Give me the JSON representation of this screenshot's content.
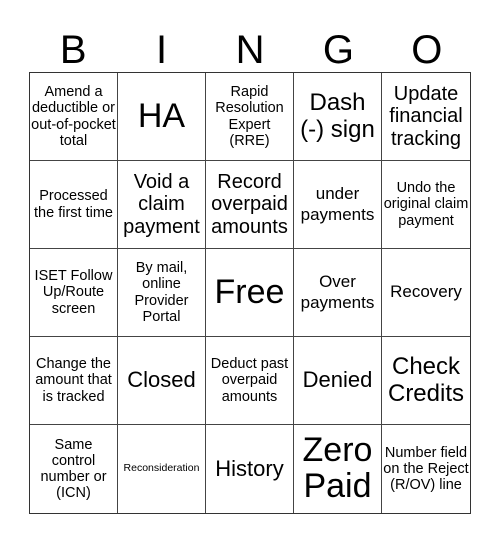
{
  "header": {
    "letters": [
      "B",
      "I",
      "N",
      "G",
      "O"
    ]
  },
  "cells": [
    "Amend a deductible or out-of-pocket total",
    "HA",
    "Rapid Resolution Expert (RRE)",
    "Dash (-) sign",
    "Update financial tracking",
    "Processed the first time",
    "Void a claim payment",
    "Record overpaid amounts",
    "under payments",
    "Undo the original claim payment",
    "ISET Follow Up/Route screen",
    "By mail, online Provider Portal",
    "Free",
    "Over payments",
    "Recovery",
    "Change the amount that is tracked",
    "Closed",
    "Deduct past overpaid amounts",
    "Denied",
    "Check Credits",
    "Same control number or (ICN)",
    "Reconsideration",
    "History",
    "Zero Paid",
    "Number field on the Reject (R/OV) line"
  ]
}
